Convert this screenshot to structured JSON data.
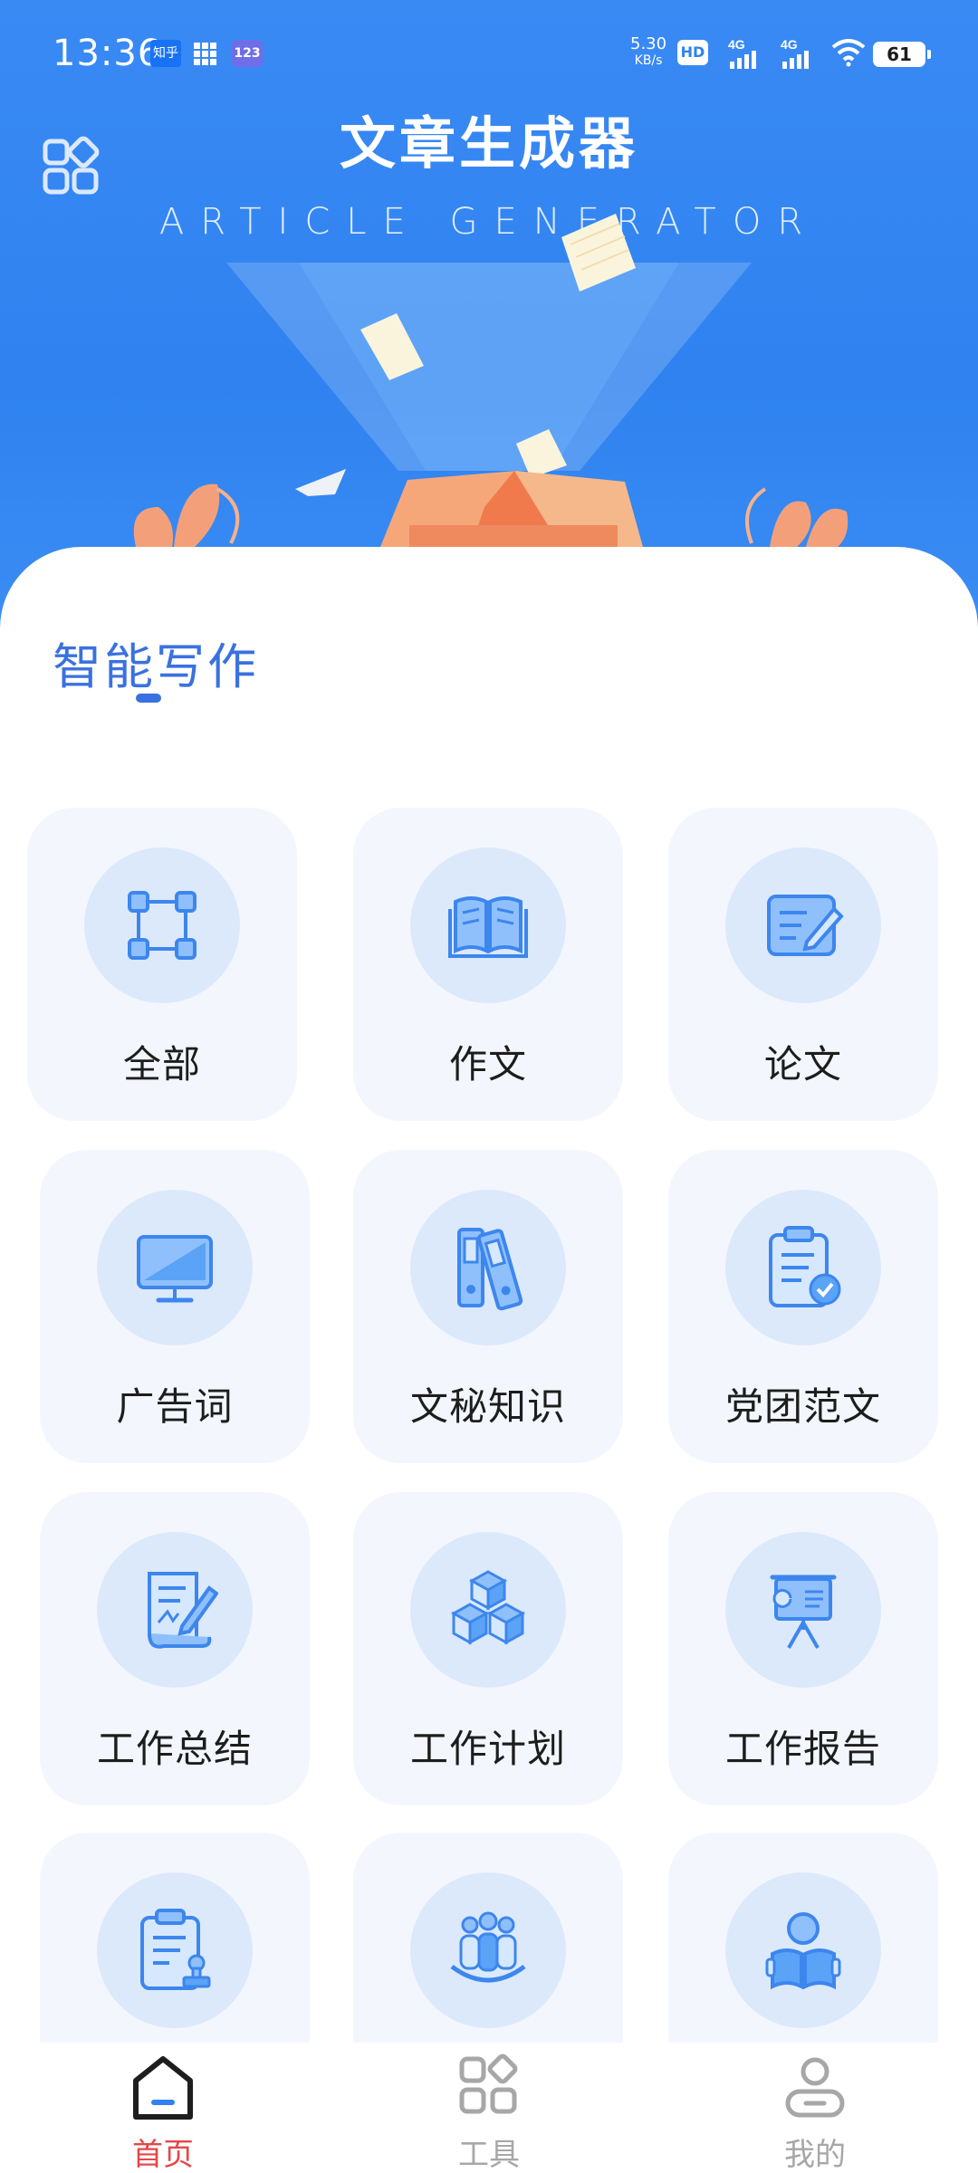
{
  "status_bar": {
    "time": "13:36",
    "app1": "知乎",
    "app3": "123",
    "net_speed_value": "5.30",
    "net_speed_unit": "KB/s",
    "hd": "HD",
    "sim1": "4G",
    "sim2": "4G",
    "battery": "61"
  },
  "header": {
    "title": "文章生成器",
    "subtitle": "ARTICLE GENERATOR",
    "menu_icon": "grid-diamond-icon"
  },
  "section": {
    "title": "智能写作"
  },
  "categories": [
    {
      "label": "全部",
      "icon": "nodes-icon"
    },
    {
      "label": "作文",
      "icon": "open-book-icon"
    },
    {
      "label": "论文",
      "icon": "edit-document-icon"
    },
    {
      "label": "广告词",
      "icon": "monitor-icon"
    },
    {
      "label": "文秘知识",
      "icon": "binders-icon"
    },
    {
      "label": "党团范文",
      "icon": "clipboard-check-icon"
    },
    {
      "label": "工作总结",
      "icon": "scroll-pen-icon"
    },
    {
      "label": "工作计划",
      "icon": "cubes-icon"
    },
    {
      "label": "工作报告",
      "icon": "presentation-board-icon"
    },
    {
      "label": "",
      "icon": "clipboard-stamp-icon"
    },
    {
      "label": "",
      "icon": "team-icon"
    },
    {
      "label": "",
      "icon": "reader-icon"
    }
  ],
  "bottom_nav": [
    {
      "label": "首页",
      "icon": "home-icon",
      "active": true
    },
    {
      "label": "工具",
      "icon": "tools-icon",
      "active": false
    },
    {
      "label": "我的",
      "icon": "profile-icon",
      "active": false
    }
  ],
  "colors": {
    "header_blue": "#2f82f0",
    "accent_blue": "#3a71e0",
    "active_red": "#e4474a",
    "card_bg": "#f3f7fd",
    "icon_circle": "#dce9fb"
  }
}
